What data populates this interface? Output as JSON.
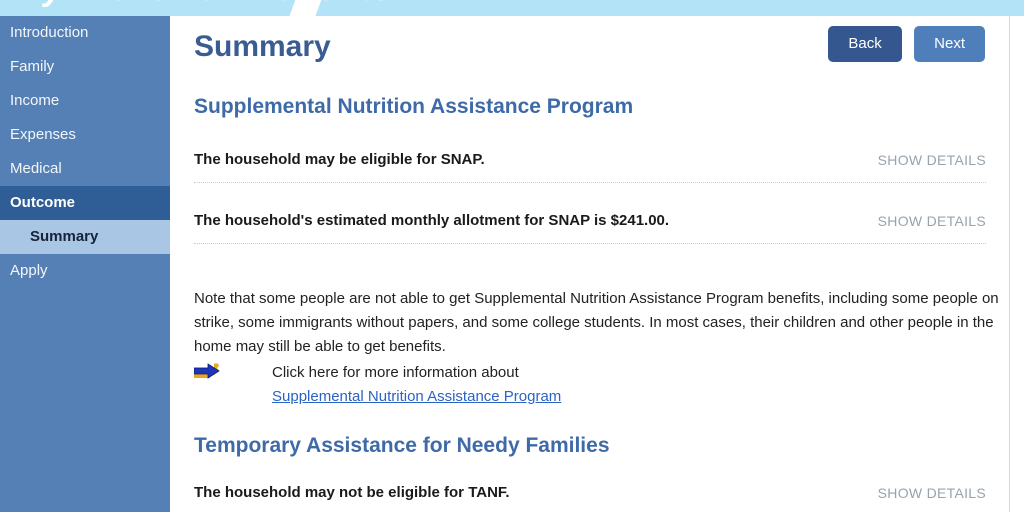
{
  "banner": {
    "text": "MyFriendBen Benefits",
    "background_color": "#b3e3f7"
  },
  "sidebar": {
    "background_color": "#5580b5",
    "items": [
      {
        "label": "Introduction",
        "state": "default"
      },
      {
        "label": "Family",
        "state": "default"
      },
      {
        "label": "Income",
        "state": "default"
      },
      {
        "label": "Expenses",
        "state": "default"
      },
      {
        "label": "Medical",
        "state": "default"
      },
      {
        "label": "Outcome",
        "state": "active-parent"
      },
      {
        "label": "Summary",
        "state": "active-sub"
      },
      {
        "label": "Apply",
        "state": "default"
      }
    ]
  },
  "header": {
    "title": "Summary",
    "back_label": "Back",
    "next_label": "Next",
    "back_color": "#34578f",
    "next_color": "#4e7fba"
  },
  "sections": [
    {
      "heading": "Supplemental Nutrition Assistance Program",
      "rows": [
        {
          "text": "The household may be eligible for SNAP.",
          "action_label": "SHOW DETAILS"
        },
        {
          "text": "The household's estimated monthly allotment for SNAP is $241.00.",
          "action_label": "SHOW DETAILS"
        }
      ],
      "note": "Note that some people are not able to get Supplemental Nutrition Assistance Program benefits, including some people on strike, some immigrants without papers, and some college students. In most cases, their children and other people in the home may still be able to get benefits.",
      "link_prefix": "Click here for more information about",
      "link_label": "Supplemental Nutrition Assistance Program",
      "link_icon": "arrow-right-icon"
    },
    {
      "heading": "Temporary Assistance for Needy Families",
      "rows": [
        {
          "text": "The household may not be eligible for TANF.",
          "action_label": "SHOW DETAILS"
        }
      ]
    }
  ],
  "colors": {
    "title": "#3b5c93",
    "section_heading": "#3f6aa8",
    "link": "#2b63c4",
    "show_details": "#97a3ad"
  }
}
